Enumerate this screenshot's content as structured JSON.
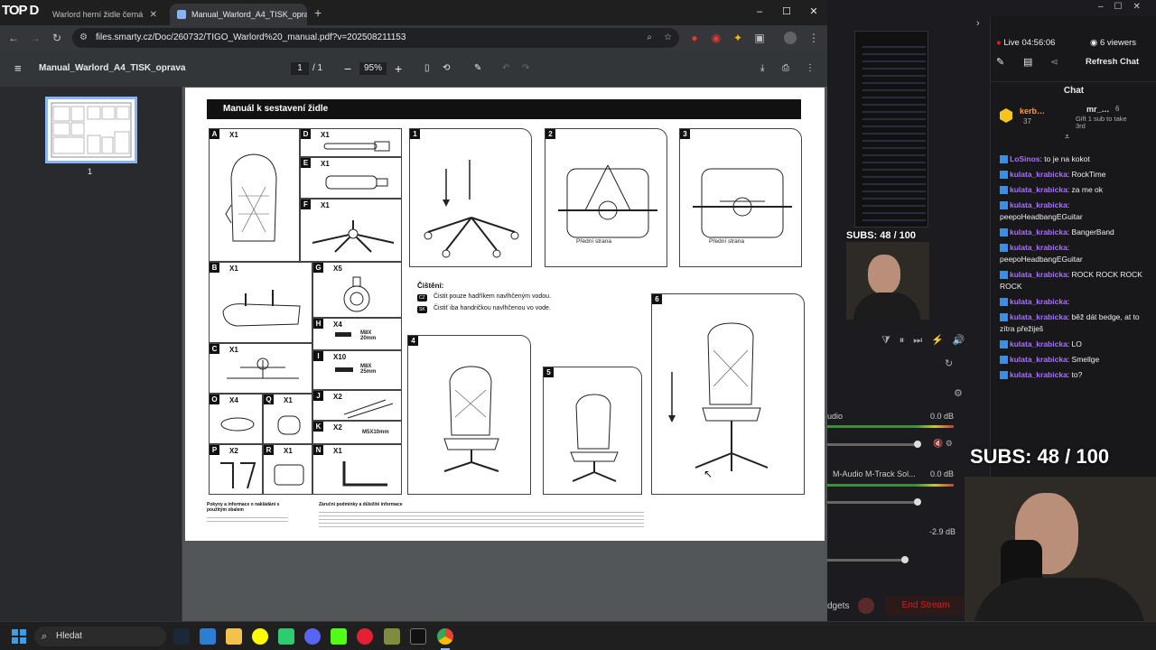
{
  "overlay_logo": "TOP D",
  "browser": {
    "tabs": [
      {
        "label": "Warlord herní židle černá"
      },
      {
        "label": "Manual_Warlord_A4_TISK_opra"
      }
    ],
    "url": "files.smarty.cz/Doc/260732/TIGO_Warlord%20_manual.pdf?v=202508211153",
    "window_controls": {
      "min": "–",
      "max": "☐",
      "close": "✕"
    }
  },
  "pdf": {
    "title": "Manual_Warlord_A4_TISK_oprava",
    "page_current": "1",
    "page_total": "/ 1",
    "zoom": "95%",
    "thumb_page": "1"
  },
  "manual": {
    "header": "Manuál k sestavení židle",
    "parts": [
      {
        "id": "A",
        "qty": "X1"
      },
      {
        "id": "D",
        "qty": "X1"
      },
      {
        "id": "E",
        "qty": "X1"
      },
      {
        "id": "F",
        "qty": "X1"
      },
      {
        "id": "B",
        "qty": "X1"
      },
      {
        "id": "G",
        "qty": "X5"
      },
      {
        "id": "H",
        "qty": "X4",
        "spec": "M8X 20mm"
      },
      {
        "id": "C",
        "qty": "X1"
      },
      {
        "id": "I",
        "qty": "X10",
        "spec": "M8X 25mm"
      },
      {
        "id": "J",
        "qty": "X2"
      },
      {
        "id": "O",
        "qty": "X4"
      },
      {
        "id": "Q",
        "qty": "X1"
      },
      {
        "id": "K",
        "qty": "X2",
        "spec": "M5X10mm"
      },
      {
        "id": "P",
        "qty": "X2"
      },
      {
        "id": "R",
        "qty": "X1"
      },
      {
        "id": "N",
        "qty": "X1"
      }
    ],
    "steps": [
      "1",
      "2",
      "3",
      "4",
      "5",
      "6"
    ],
    "front_label": "Přední strana",
    "cleaning_title": "Čištění:",
    "cleaning_cz_tag": "CZ",
    "cleaning_cz": "Čistit pouze hadříkem navlhčeným vodou.",
    "cleaning_sk_tag": "SK",
    "cleaning_sk": "Čistiť iba handričkou navlhčenou vo vode.",
    "footer_left_title": "Pokyny a informace o nakládání s použitým obalem",
    "footer_right_title": "Záruční podmínky a důležité informace"
  },
  "stream": {
    "live_time": "Live 04:56:06",
    "viewers": "6 viewers",
    "refresh": "Refresh Chat",
    "chat_title": "Chat",
    "pinned_user": "kerb…",
    "pinned_count": "37",
    "pinned_user2": "mr_…",
    "pinned_count2": "6",
    "pinned_msg": "Gift 1 sub to take 3rd",
    "subs_small": "SUBS: 48 / 100",
    "subs_big": "SUBS: 48 / 100",
    "audio_0": "0.0 dB",
    "audio_src_1": "udio",
    "audio_src_2": "M-Audio M-Track Sol...",
    "audio_1": "0.0 dB",
    "audio_2": "-2.9 dB",
    "gadgets": "dgets",
    "end_stream": "End Stream",
    "messages": [
      {
        "user": "LoSinos",
        "text": ": to je na kokot"
      },
      {
        "user": "kulata_krabicka",
        "text": ": RockTime"
      },
      {
        "user": "kulata_krabicka",
        "text": ": za me ok"
      },
      {
        "user": "kulata_krabicka",
        "text": ": peepoHeadbangEGuitar"
      },
      {
        "user": "kulata_krabicka",
        "text": ": BangerBand"
      },
      {
        "user": "kulata_krabicka",
        "text": ": peepoHeadbangEGuitar"
      },
      {
        "user": "kulata_krabicka",
        "text": ": ROCK ROCK ROCK ROCK"
      },
      {
        "user": "kulata_krabicka",
        "text": ":"
      },
      {
        "user": "kulata_krabicka",
        "text": ": běž dát bedge, at to zítra přežiješ"
      },
      {
        "user": "kulata_krabicka",
        "text": ": LO"
      },
      {
        "user": "kulata_krabicka",
        "text": ": Smellge"
      },
      {
        "user": "kulata_krabicka",
        "text": ": to?"
      }
    ]
  },
  "taskbar": {
    "search_placeholder": "Hledat"
  },
  "colors": {
    "chrome_bg": "#202124",
    "pdf_bg": "#525659",
    "twitch_purple": "#a970ff",
    "end_stream": "#e91916"
  }
}
